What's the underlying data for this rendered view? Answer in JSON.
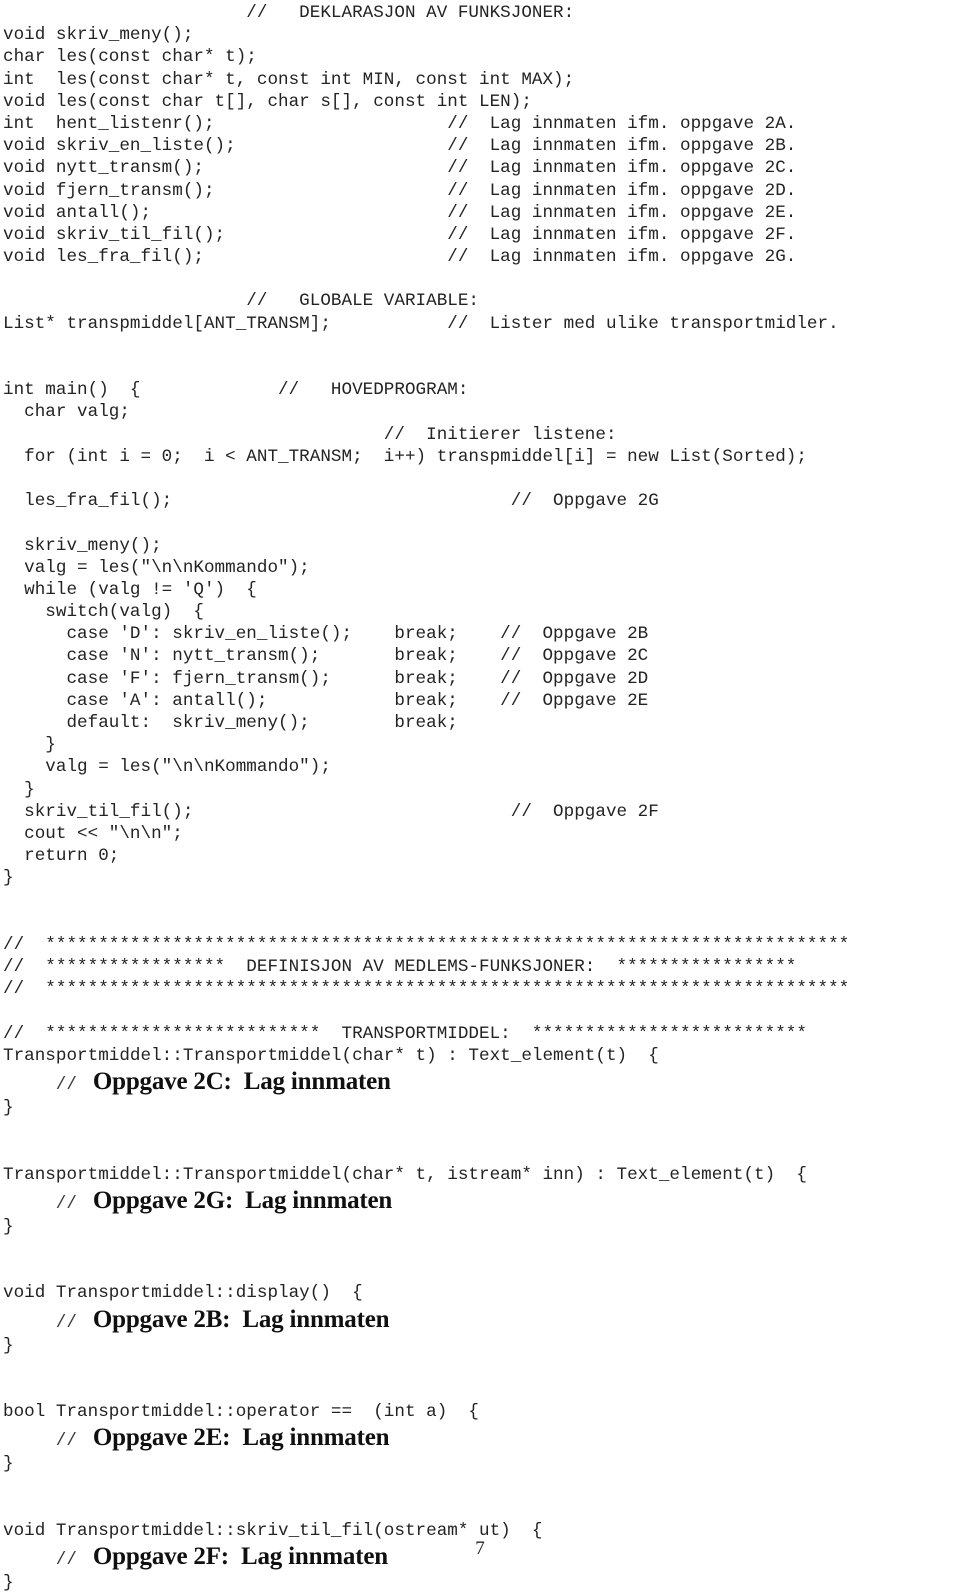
{
  "document": {
    "page_number": "7",
    "language": "C++ source listing (Norwegian)"
  },
  "code": {
    "lines": [
      "                       //   DEKLARASJON AV FUNKSJONER:",
      "void skriv_meny();",
      "char les(const char* t);",
      "int  les(const char* t, const int MIN, const int MAX);",
      "void les(const char t[], char s[], const int LEN);",
      "int  hent_listenr();                      //  Lag innmaten ifm. oppgave 2A.",
      "void skriv_en_liste();                    //  Lag innmaten ifm. oppgave 2B.",
      "void nytt_transm();                       //  Lag innmaten ifm. oppgave 2C.",
      "void fjern_transm();                      //  Lag innmaten ifm. oppgave 2D.",
      "void antall();                            //  Lag innmaten ifm. oppgave 2E.",
      "void skriv_til_fil();                     //  Lag innmaten ifm. oppgave 2F.",
      "void les_fra_fil();                       //  Lag innmaten ifm. oppgave 2G.",
      "",
      "                       //   GLOBALE VARIABLE:",
      "List* transpmiddel[ANT_TRANSM];           //  Lister med ulike transportmidler.",
      "",
      "",
      "int main()  {             //   HOVEDPROGRAM:",
      "  char valg;",
      "                                    //  Initierer listene:",
      "  for (int i = 0;  i < ANT_TRANSM;  i++) transpmiddel[i] = new List(Sorted);",
      "",
      "  les_fra_fil();                                //  Oppgave 2G",
      "",
      "  skriv_meny();",
      "  valg = les(\"\\n\\nKommando\");",
      "  while (valg != 'Q')  {",
      "    switch(valg)  {",
      "      case 'D': skriv_en_liste();    break;    //  Oppgave 2B",
      "      case 'N': nytt_transm();       break;    //  Oppgave 2C",
      "      case 'F': fjern_transm();      break;    //  Oppgave 2D",
      "      case 'A': antall();            break;    //  Oppgave 2E",
      "      default:  skriv_meny();        break;",
      "    }",
      "    valg = les(\"\\n\\nKommando\");",
      "  }",
      "  skriv_til_fil();                              //  Oppgave 2F",
      "  cout << \"\\n\\n\";",
      "  return 0;",
      "}",
      "",
      "",
      "//  ****************************************************************************",
      "//  *****************  DEFINISJON AV MEDLEMS-FUNKSJONER:  *****************",
      "//  ****************************************************************************",
      "",
      "//  **************************  TRANSPORTMIDDEL:  **************************",
      "Transportmiddel::Transportmiddel(char* t) : Text_element(t)  {"
    ]
  },
  "sections": [
    {
      "annotation": {
        "slashes": "     //",
        "text": "Oppgave 2C:  Lag innmaten"
      },
      "closing_brace": "}",
      "blank_after": 2,
      "signature": "Transportmiddel::Transportmiddel(char* t, istream* inn) : Text_element(t)  {"
    },
    {
      "annotation": {
        "slashes": "     //",
        "text": "Oppgave 2G:  Lag innmaten"
      },
      "closing_brace": "}",
      "blank_after": 2,
      "signature": "void Transportmiddel::display()  {"
    },
    {
      "annotation": {
        "slashes": "     //",
        "text": "Oppgave 2B:  Lag innmaten"
      },
      "closing_brace": "}",
      "blank_after": 2,
      "signature": "bool Transportmiddel::operator ==  (int a)  {"
    },
    {
      "annotation": {
        "slashes": "     //",
        "text": "Oppgave 2E:  Lag innmaten"
      },
      "closing_brace": "}",
      "blank_after": 2,
      "signature": "void Transportmiddel::skriv_til_fil(ostream* ut)  {"
    },
    {
      "annotation": {
        "slashes": "     //",
        "text": "Oppgave 2F:  Lag innmaten"
      },
      "closing_brace": "}",
      "blank_after": 0,
      "signature": ""
    }
  ]
}
